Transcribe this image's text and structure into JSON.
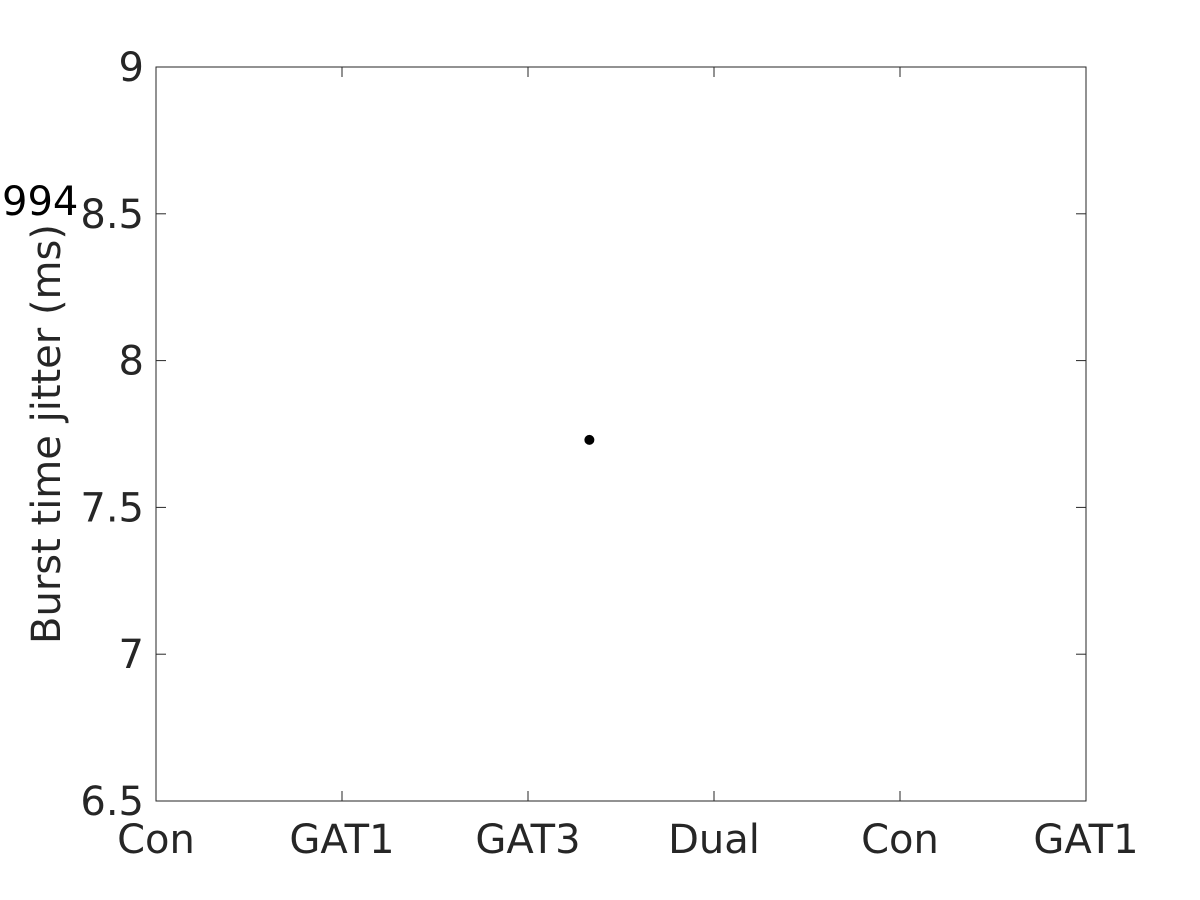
{
  "chart_data": {
    "type": "scatter",
    "title": "",
    "xlabel": "",
    "ylabel": "Burst time jitter (ms)",
    "x_tick_labels": [
      "Con",
      "GAT1",
      "GAT3",
      "Dual",
      "Con",
      "GAT1"
    ],
    "xlim": [
      0,
      5
    ],
    "ylim": [
      6.5,
      9
    ],
    "y_ticks": [
      6.5,
      7,
      7.5,
      8,
      8.5,
      9
    ],
    "y_tick_labels": [
      "6.5",
      "7",
      "7.5",
      "8",
      "8.5",
      "9"
    ],
    "grid": false,
    "legend": null,
    "series": [
      {
        "name": "points",
        "color": "#000000",
        "points": [
          {
            "x": 2.33,
            "y": 7.73
          }
        ]
      }
    ],
    "annotations": [
      {
        "text": "994"
      }
    ]
  },
  "colors": {
    "axis": "#262626",
    "marker": "#000000",
    "background": "#ffffff"
  }
}
